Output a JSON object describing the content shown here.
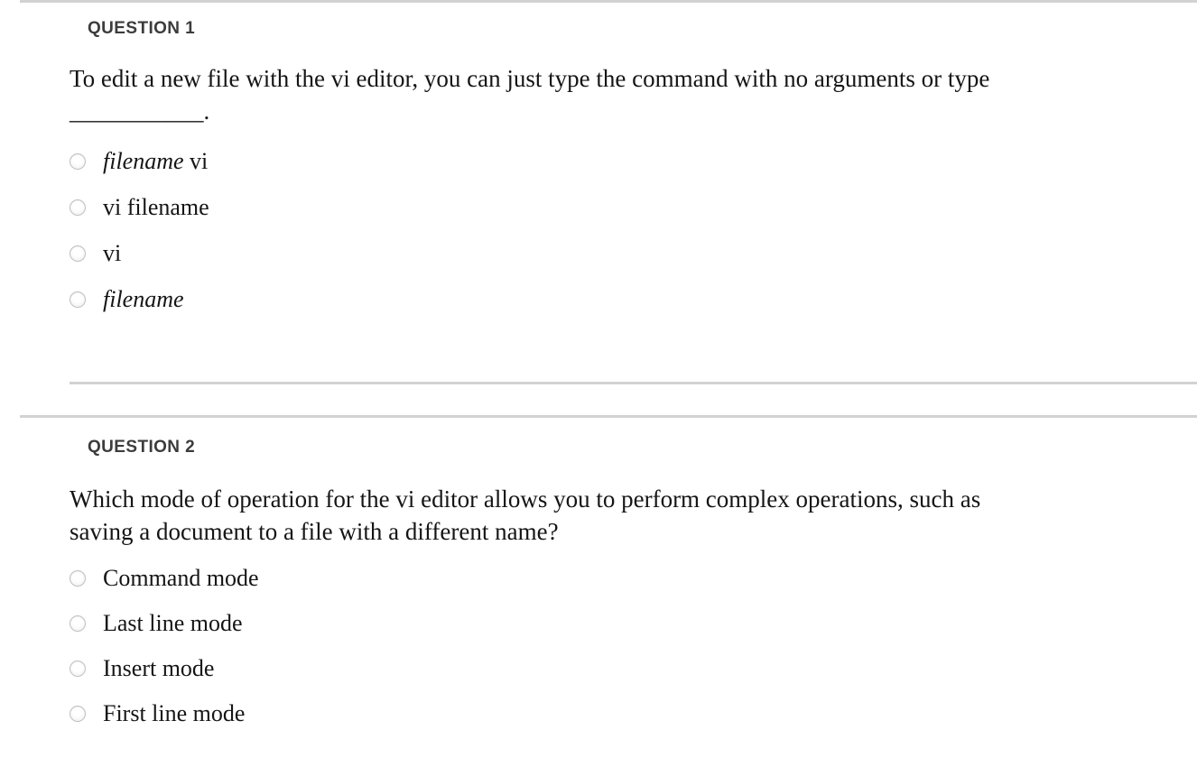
{
  "page": {
    "background": "#ffffff",
    "header_color": "#3c3c3c",
    "text_color": "#151515",
    "rule_color": "#d2d2d2"
  },
  "questions": [
    {
      "header": "QUESTION 1",
      "body_line_1": "To edit a new file with the vi editor, you can just type the command with no arguments or type",
      "body_line_2_blank": "___________",
      "body_line_2_end": ".",
      "options": [
        {
          "italic_part": "filename",
          "plain_part": " vi",
          "text": "filename vi"
        },
        {
          "italic_part": "",
          "plain_part": "vi filename",
          "text": "vi filename"
        },
        {
          "italic_part": "",
          "plain_part": "vi",
          "text": "vi"
        },
        {
          "italic_part": "filename",
          "plain_part": "",
          "text": "filename"
        }
      ]
    },
    {
      "header": "QUESTION 2",
      "body_line_1": "Which mode of operation for the vi editor allows you to perform complex operations, such as",
      "body_line_2": "saving a document to a file with a different name?",
      "options": [
        {
          "italic_part": "",
          "plain_part": "Command mode",
          "text": "Command mode"
        },
        {
          "italic_part": "",
          "plain_part": "Last line mode",
          "text": "Last line mode"
        },
        {
          "italic_part": "",
          "plain_part": "Insert mode",
          "text": "Insert mode"
        },
        {
          "italic_part": "",
          "plain_part": "First line mode",
          "text": "First line mode"
        }
      ]
    }
  ]
}
